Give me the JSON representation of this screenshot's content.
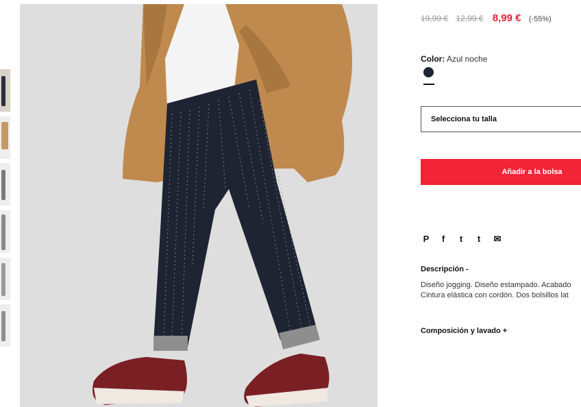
{
  "product": {
    "price_original": "19,99 €",
    "price_previous": "12,99 €",
    "price_current": "8,99 €",
    "discount": "(-55%)",
    "color_label": "Color:",
    "color_value": "Azul noche",
    "swatch_color": "#1e2431",
    "size_placeholder": "Selecciona tu talla",
    "add_button": "Añadir a la bolsa"
  },
  "social": {
    "pinterest": "P",
    "facebook": "f",
    "twitter": "t",
    "tumblr": "t",
    "email": "✉"
  },
  "description": {
    "title": "Descripción  -",
    "line1": "Diseño jogging. Diseño estampado. Acabado",
    "line2": "Cintura elástica con cordón. Dos bolsillos lat"
  },
  "composition": {
    "title": "Composición y lavado  +"
  },
  "colors": {
    "accent": "#f22437",
    "sale": "#e32235"
  }
}
